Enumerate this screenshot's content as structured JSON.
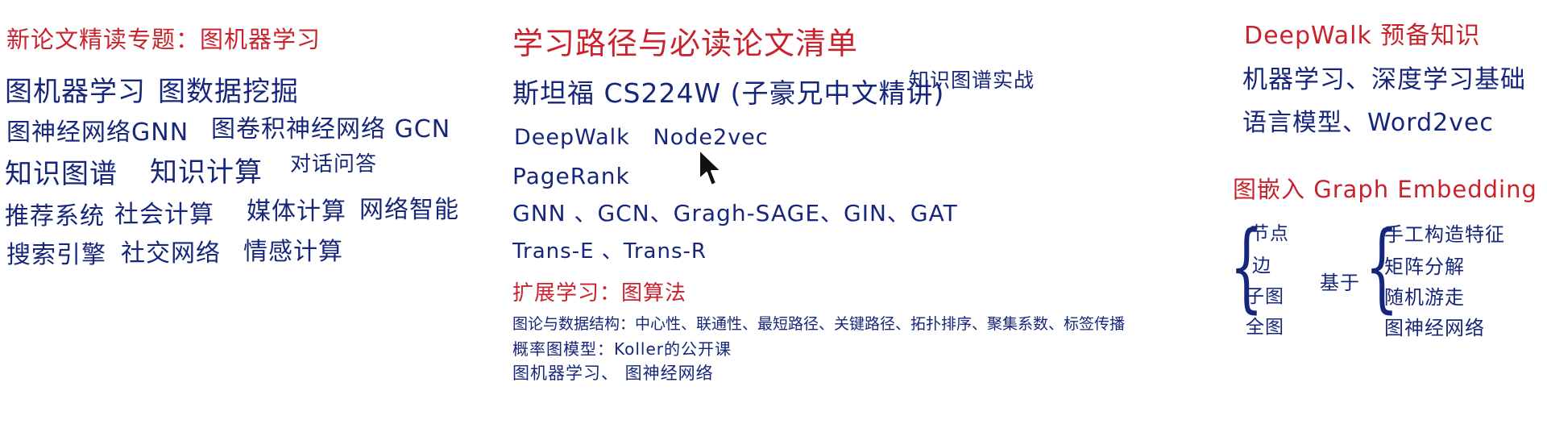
{
  "colors": {
    "red": "#c8232c",
    "blue": "#16267a"
  },
  "left": {
    "heading": "新论文精读专题：图机器学习",
    "lines": [
      [
        "图机器学习",
        "图数据挖掘"
      ],
      [
        "图神经网络GNN",
        "图卷积神经网络 GCN"
      ],
      [
        "知识图谱",
        "知识计算",
        "对话问答"
      ],
      [
        "推荐系统",
        "社会计算",
        "媒体计算",
        "网络智能"
      ],
      [
        "搜索引擎",
        "社交网络",
        "情感计算"
      ]
    ]
  },
  "middle": {
    "heading": "学习路径与必读论文清单",
    "course": "斯坦福 CS224W (子豪兄中文精讲)",
    "course_note": "知识图谱实战",
    "papers": {
      "line1": "DeepWalk   Node2vec",
      "line2": "PageRank",
      "line3": "GNN 、GCN、Gragh-SAGE、GIN、GAT",
      "line4": "Trans-E 、Trans-R"
    },
    "extension_heading": "扩展学习：图算法",
    "extension": [
      "图论与数据结构：中心性、联通性、最短路径、关键路径、拓扑排序、聚集系数、标签传播",
      "概率图模型：Koller的公开课",
      "图机器学习、 图神经网络"
    ]
  },
  "right": {
    "heading": "DeepWalk 预备知识",
    "prereq": [
      "机器学习、深度学习基础",
      "语言模型、Word2vec"
    ],
    "embedding_heading": "图嵌入 Graph Embedding",
    "levels": [
      "节点",
      "边",
      "子图",
      "全图"
    ],
    "basis_label": "基于",
    "methods": [
      "手工构造特征",
      "矩阵分解",
      "随机游走",
      "图神经网络"
    ]
  },
  "icons": {
    "cursor": "mouse-pointer-icon"
  }
}
